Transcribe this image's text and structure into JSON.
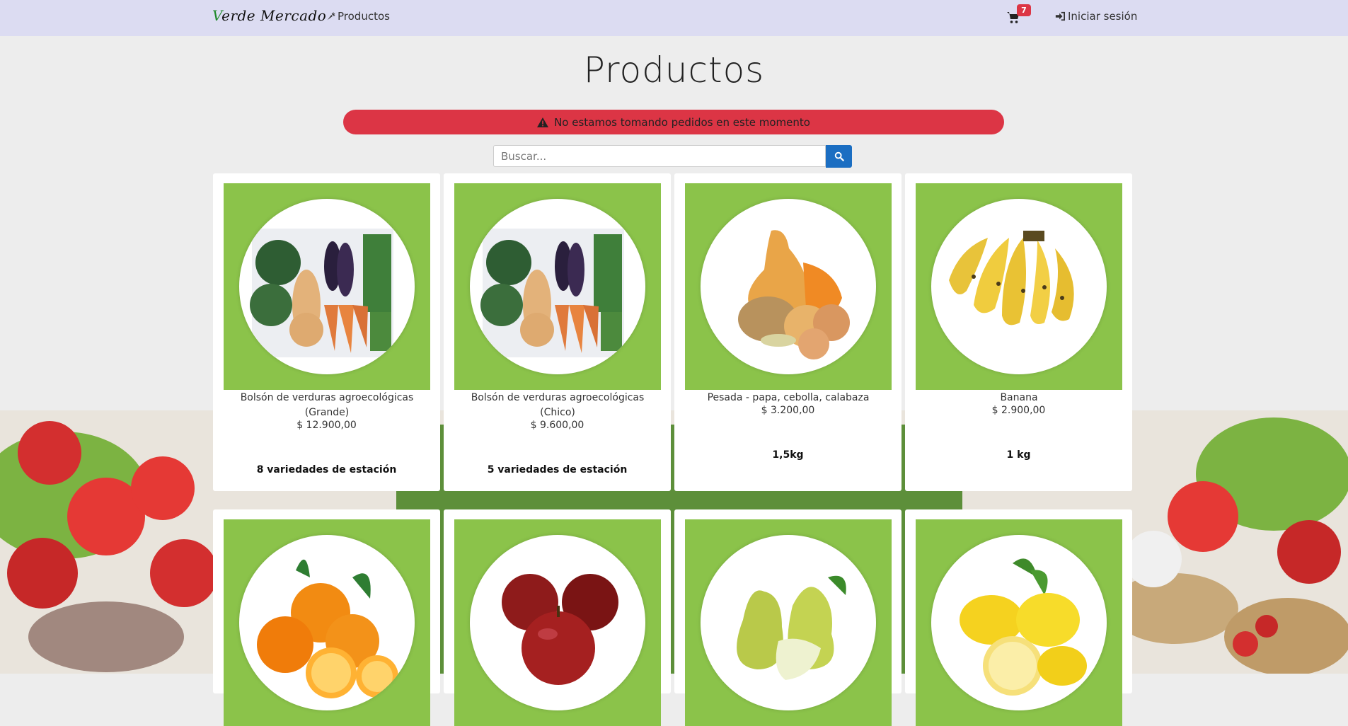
{
  "app": {
    "brand_first": "V",
    "brand_rest": "erde Mercado",
    "nav_products": "Productos",
    "cart_count": "7",
    "login_label": "Iniciar sesión"
  },
  "page": {
    "title": "Productos",
    "alert": "No estamos tomando pedidos en este momento"
  },
  "search": {
    "placeholder": "Buscar..."
  },
  "colors": {
    "navbar": "#dcdcf2",
    "alert": "#dc3545",
    "card_image_bg": "#8bc34a",
    "search_button": "#1b6ec2"
  },
  "products": [
    {
      "name": "Bolsón de verduras agroecológicas (Grande)",
      "price": "$ 12.900,00",
      "desc": "8 variedades de estación",
      "image": "vegetable-bag"
    },
    {
      "name": "Bolsón de verduras agroecológicas (Chico)",
      "price": "$ 9.600,00",
      "desc": "5 variedades de estación",
      "image": "vegetable-bag"
    },
    {
      "name": "Pesada - papa, cebolla, calabaza",
      "price": "$ 3.200,00",
      "desc": "1,5kg",
      "image": "potato-onion-squash"
    },
    {
      "name": "Banana",
      "price": "$ 2.900,00",
      "desc": "1 kg",
      "image": "banana"
    },
    {
      "name": "",
      "price": "",
      "desc": "",
      "image": "orange"
    },
    {
      "name": "",
      "price": "",
      "desc": "",
      "image": "apple"
    },
    {
      "name": "",
      "price": "",
      "desc": "",
      "image": "pear"
    },
    {
      "name": "",
      "price": "",
      "desc": "",
      "image": "lemon"
    }
  ]
}
